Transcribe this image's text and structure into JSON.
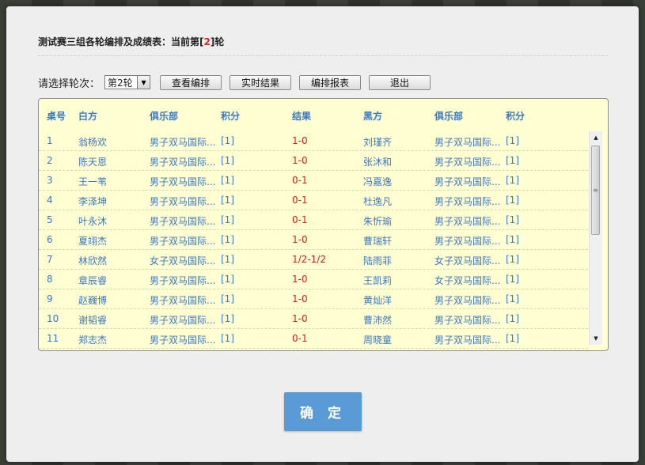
{
  "dialog": {
    "title_prefix": "测试赛三组各轮编排及成绩表：当前第[",
    "title_round": "2",
    "title_suffix": "]轮"
  },
  "controls": {
    "round_label": "请选择轮次：",
    "round_selected": "第2轮",
    "buttons": {
      "view_pairing": "查看编排",
      "live_results": "实时结果",
      "pairing_report": "编排报表",
      "exit": "退出"
    }
  },
  "table": {
    "headers": [
      "桌号",
      "白方",
      "俱乐部",
      "积分",
      "结果",
      "黑方",
      "俱乐部",
      "积分"
    ],
    "rows": [
      [
        "1",
        "翁杨欢",
        "男子双马国际...",
        "[1]",
        "1-0",
        "刘瑾齐",
        "男子双马国际...",
        "[1]"
      ],
      [
        "2",
        "陈天恩",
        "男子双马国际...",
        "[1]",
        "1-0",
        "张沐和",
        "男子双马国际...",
        "[1]"
      ],
      [
        "3",
        "王一苇",
        "男子双马国际...",
        "[1]",
        "0-1",
        "冯嘉逸",
        "男子双马国际...",
        "[1]"
      ],
      [
        "4",
        "李泽坤",
        "男子双马国际...",
        "[1]",
        "0-1",
        "杜逸凡",
        "男子双马国际...",
        "[1]"
      ],
      [
        "5",
        "叶永沐",
        "男子双马国际...",
        "[1]",
        "0-1",
        "朱忻瑜",
        "男子双马国际...",
        "[1]"
      ],
      [
        "6",
        "夏翊杰",
        "男子双马国际...",
        "[1]",
        "1-0",
        "曹瑞轩",
        "男子双马国际...",
        "[1]"
      ],
      [
        "7",
        "林欣然",
        "女子双马国际...",
        "[1]",
        "1/2-1/2",
        "陆雨菲",
        "女子双马国际...",
        "[1]"
      ],
      [
        "8",
        "章辰睿",
        "男子双马国际...",
        "[1]",
        "1-0",
        "王凯莉",
        "女子双马国际...",
        "[1]"
      ],
      [
        "9",
        "赵巍博",
        "男子双马国际...",
        "[1]",
        "1-0",
        "黄灿洋",
        "男子双马国际...",
        "[1]"
      ],
      [
        "10",
        "谢韬睿",
        "男子双马国际...",
        "[1]",
        "1-0",
        "曹沛然",
        "男子双马国际...",
        "[1]"
      ],
      [
        "11",
        "郑志杰",
        "男子双马国际...",
        "[1]",
        "0-1",
        "周晓童",
        "男子双马国际...",
        "[1]"
      ]
    ]
  },
  "footer": {
    "confirm_label": "确 定"
  },
  "colors": {
    "link_blue": "#3a78c4",
    "result_red": "#d42020",
    "panel_bg": "#ffffd2",
    "confirm_bg": "#5b9bd5"
  },
  "icons": {
    "dropdown": "chevron-down-icon",
    "scroll_up": "arrow-up-icon",
    "scroll_down": "arrow-down-icon"
  }
}
